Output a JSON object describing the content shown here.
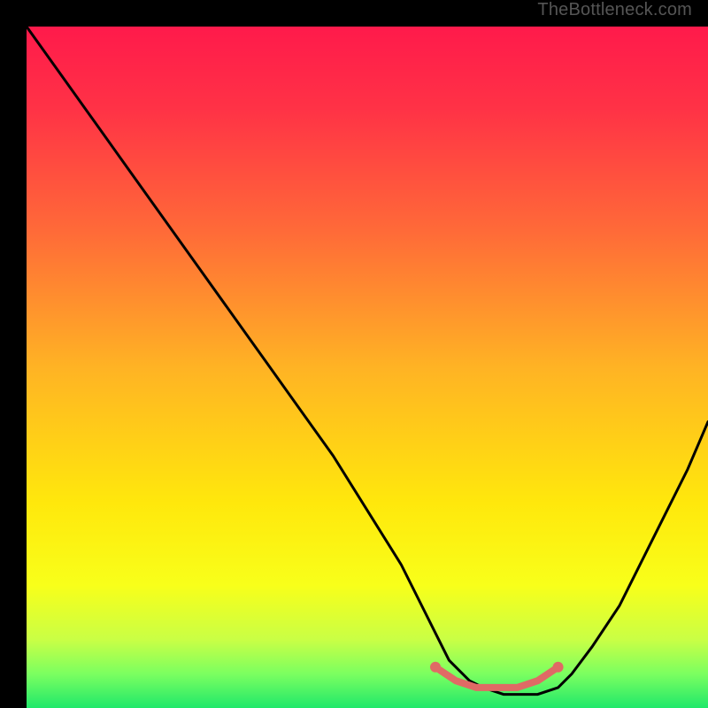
{
  "watermark": "TheBottleneck.com",
  "chart_data": {
    "type": "line",
    "title": "",
    "xlabel": "",
    "ylabel": "",
    "xlim": [
      0,
      100
    ],
    "ylim": [
      0,
      100
    ],
    "background_gradient": {
      "stops": [
        {
          "pos": 0.0,
          "color": "#ff1a4b"
        },
        {
          "pos": 0.12,
          "color": "#ff3246"
        },
        {
          "pos": 0.3,
          "color": "#ff6a38"
        },
        {
          "pos": 0.5,
          "color": "#ffb324"
        },
        {
          "pos": 0.7,
          "color": "#ffe80c"
        },
        {
          "pos": 0.82,
          "color": "#f8ff1a"
        },
        {
          "pos": 0.9,
          "color": "#c9ff45"
        },
        {
          "pos": 0.95,
          "color": "#7bff60"
        },
        {
          "pos": 1.0,
          "color": "#20e86a"
        }
      ]
    },
    "series": [
      {
        "name": "bottleneck-curve",
        "color": "#000000",
        "x": [
          0,
          5,
          10,
          15,
          20,
          25,
          30,
          35,
          40,
          45,
          50,
          55,
          58,
          60,
          62,
          65,
          67,
          70,
          72,
          75,
          78,
          80,
          83,
          87,
          90,
          94,
          97,
          100
        ],
        "y": [
          100,
          93,
          86,
          79,
          72,
          65,
          58,
          51,
          44,
          37,
          29,
          21,
          15,
          11,
          7,
          4,
          3,
          2,
          2,
          2,
          3,
          5,
          9,
          15,
          21,
          29,
          35,
          42
        ]
      }
    ],
    "highlight_segment": {
      "name": "optimal-range",
      "color": "#e06a65",
      "x": [
        60,
        63,
        66,
        69,
        72,
        75,
        78
      ],
      "y": [
        6,
        4,
        3,
        3,
        3,
        4,
        6
      ],
      "endpoints": [
        {
          "x": 60,
          "y": 6
        },
        {
          "x": 78,
          "y": 6
        }
      ]
    }
  }
}
